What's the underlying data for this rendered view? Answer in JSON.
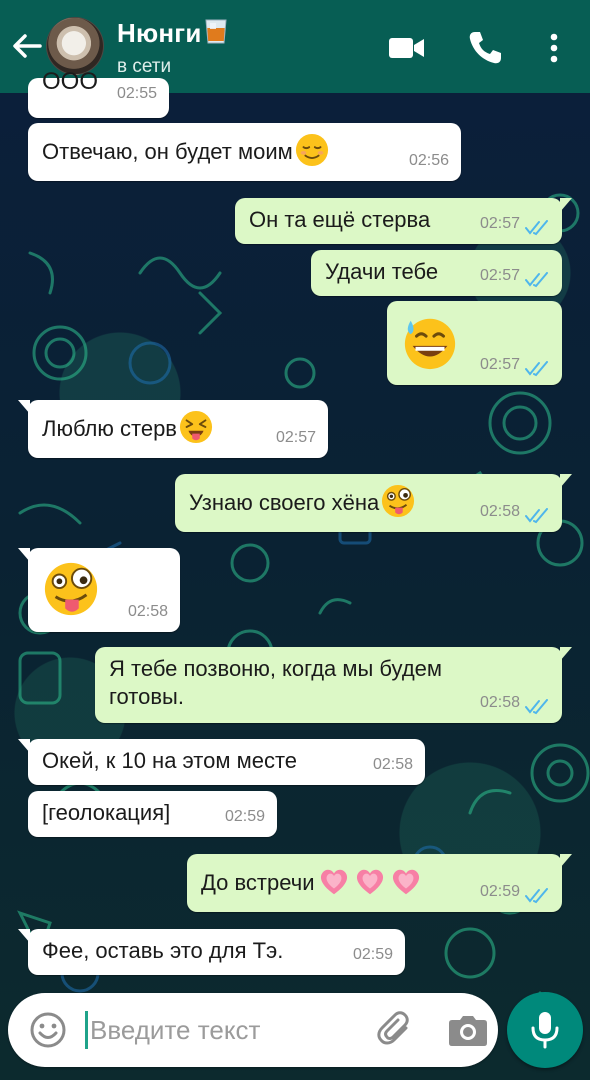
{
  "header": {
    "contact_name": "Нюнги",
    "name_emoji": "tumbler-glass-emoji",
    "status": "в сети",
    "icons": [
      "back-arrow-icon",
      "avatar",
      "video-call-icon",
      "phone-call-icon",
      "more-options-icon"
    ],
    "color": "#075e54"
  },
  "messages": [
    {
      "dir": "in",
      "text": "ООО",
      "time": "02:55",
      "partial": true
    },
    {
      "dir": "in",
      "text": "Отвечаю, он будет моим",
      "emoji": "relieved-face",
      "time": "02:56"
    },
    {
      "dir": "out",
      "text": "Он та ещё стерва",
      "time": "02:57",
      "status": "read"
    },
    {
      "dir": "out",
      "text": "Удачи тебе",
      "time": "02:57",
      "status": "read"
    },
    {
      "dir": "out",
      "text": "",
      "emoji": "grinning-face-with-sweat",
      "time": "02:57",
      "status": "read"
    },
    {
      "dir": "in",
      "text": "Люблю стерв",
      "emoji": "squinting-face-with-tongue",
      "time": "02:57"
    },
    {
      "dir": "out",
      "text": "Узнаю своего хёна",
      "emoji": "zany-face",
      "time": "02:58",
      "status": "read"
    },
    {
      "dir": "in",
      "text": "",
      "emoji": "zany-face",
      "time": "02:58"
    },
    {
      "dir": "out",
      "text": "Я тебе позвоню, когда мы будем",
      "text2": "готовы.",
      "time": "02:58",
      "status": "read"
    },
    {
      "dir": "in",
      "text": "Окей, к 10 на этом месте",
      "time": "02:58"
    },
    {
      "dir": "in",
      "text": "[геолокация]",
      "time": "02:59"
    },
    {
      "dir": "out",
      "text": "До встречи",
      "emoji": "growing-heart x3",
      "time": "02:59",
      "status": "read"
    },
    {
      "dir": "in",
      "text": "Фее, оставь это для Тэ.",
      "time": "02:59"
    }
  ],
  "composer": {
    "placeholder": "Введите текст",
    "value": "",
    "icons": [
      "emoji-icon",
      "attach-icon",
      "camera-icon",
      "mic-icon"
    ],
    "accent": "#00897b"
  },
  "colors": {
    "incoming_bubble": "#ffffff",
    "outgoing_bubble": "#dcf8c6",
    "read_ticks": "#4fb6ec"
  }
}
